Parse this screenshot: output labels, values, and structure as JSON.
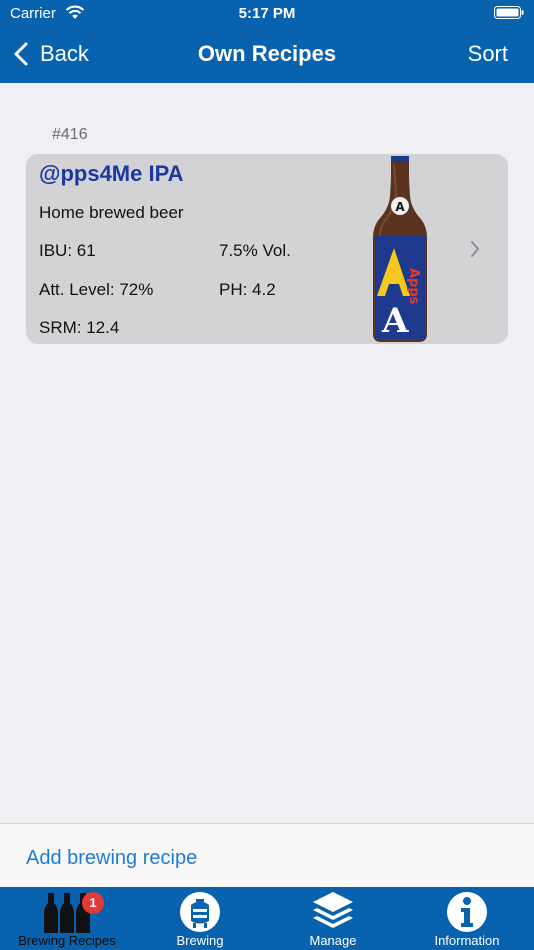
{
  "status_bar": {
    "carrier": "Carrier",
    "time": "5:17 PM"
  },
  "nav": {
    "back_label": "Back",
    "title": "Own Recipes",
    "sort_label": "Sort"
  },
  "section": {
    "header": "#416"
  },
  "recipe": {
    "name": "@pps4Me IPA",
    "description": "Home brewed beer",
    "ibu": "IBU: 61",
    "volume": "7.5% Vol.",
    "attenuation": "Att. Level: 72%",
    "ph": "PH: 4.2",
    "srm": "SRM: 12.4",
    "bottle_label": "Apps"
  },
  "footer": {
    "add_label": "Add brewing recipe"
  },
  "tabs": [
    {
      "label": "Brewing Recipes",
      "icon": "bottles-icon",
      "badge": "1",
      "selected": true
    },
    {
      "label": "Brewing",
      "icon": "brew-kettle-icon"
    },
    {
      "label": "Manage",
      "icon": "layers-icon"
    },
    {
      "label": "Information",
      "icon": "info-icon"
    }
  ],
  "colors": {
    "header": "#0862ad",
    "accent": "#1f7cd6",
    "recipe_title": "#1a3a9c",
    "badge": "#e53935"
  }
}
